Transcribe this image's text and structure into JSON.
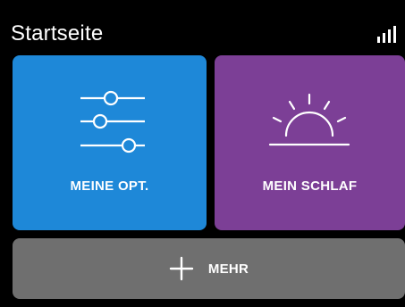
{
  "header": {
    "title": "Startseite",
    "signal_icon": "signal-strength-icon"
  },
  "tiles": {
    "options": {
      "label": "MEINE OPT.",
      "icon": "sliders-icon",
      "color": "#1e88d8"
    },
    "sleep": {
      "label": "MEIN SCHLAF",
      "icon": "sunrise-icon",
      "color": "#7c3f96"
    },
    "more": {
      "label": "MEHR",
      "icon": "plus-icon",
      "color": "#6f6f6f"
    }
  }
}
